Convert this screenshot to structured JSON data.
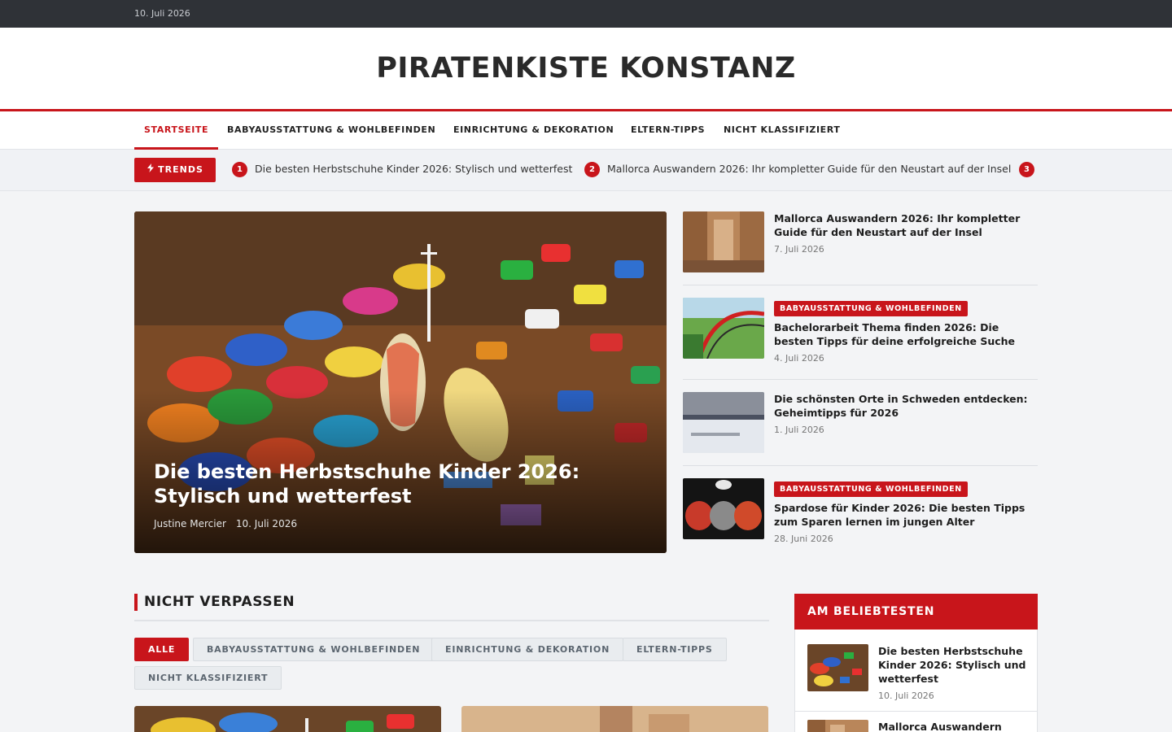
{
  "topbar": {
    "date": "10. Juli 2026"
  },
  "site": {
    "title": "PIRATENKISTE KONSTANZ"
  },
  "nav": {
    "items": [
      {
        "label": "STARTSEITE",
        "active": true
      },
      {
        "label": "BABYAUSSTATTUNG & WOHLBEFINDEN",
        "active": false
      },
      {
        "label": "EINRICHTUNG & DEKORATION",
        "active": false
      },
      {
        "label": "ELTERN-TIPPS",
        "active": false
      },
      {
        "label": "NICHT KLASSIFIZIERT",
        "active": false
      }
    ]
  },
  "trends": {
    "label": "TRENDS",
    "icon": "bolt-icon",
    "items": [
      {
        "num": "1",
        "text": "Die besten Herbstschuhe Kinder 2026: Stylisch und wetterfest"
      },
      {
        "num": "2",
        "text": "Mallorca Auswandern 2026: Ihr kompletter Guide für den Neustart auf der Insel"
      },
      {
        "num": "3",
        "text": ""
      }
    ]
  },
  "hero": {
    "title": "Die besten Herbstschuhe Kinder 2026: Stylisch und wetterfest",
    "author": "Justine Mercier",
    "date": "10. Juli 2026"
  },
  "side_articles": [
    {
      "category": "",
      "title": "Mallorca Auswandern 2026: Ihr kompletter Guide für den Neustart auf der Insel",
      "date": "7. Juli 2026"
    },
    {
      "category": "BABYAUSSTATTUNG & WOHLBEFINDEN",
      "title": "Bachelorarbeit Thema finden 2026: Die besten Tipps für deine erfolgreiche Suche",
      "date": "4. Juli 2026"
    },
    {
      "category": "",
      "title": "Die schönsten Orte in Schweden entdecken: Geheimtipps für 2026",
      "date": "1. Juli 2026"
    },
    {
      "category": "BABYAUSSTATTUNG & WOHLBEFINDEN",
      "title": "Spardose für Kinder 2026: Die besten Tipps zum Sparen lernen im jungen Alter",
      "date": "28. Juni 2026"
    }
  ],
  "section": {
    "title": "NICHT VERPASSEN"
  },
  "filters": [
    {
      "label": "ALLE",
      "active": true
    },
    {
      "label": "BABYAUSSTATTUNG & WOHLBEFINDEN",
      "active": false
    },
    {
      "label": "EINRICHTUNG & DEKORATION",
      "active": false
    },
    {
      "label": "ELTERN-TIPPS",
      "active": false
    },
    {
      "label": "NICHT KLASSIFIZIERT",
      "active": false
    }
  ],
  "popular": {
    "title": "AM BELIEBTESTEN",
    "items": [
      {
        "title": "Die besten Herbstschuhe Kinder 2026: Stylisch und wetterfest",
        "date": "10. Juli 2026"
      },
      {
        "title": "Mallorca Auswandern",
        "date": ""
      }
    ]
  },
  "colors": {
    "accent": "#c8151b",
    "topbar": "#2f3237"
  }
}
